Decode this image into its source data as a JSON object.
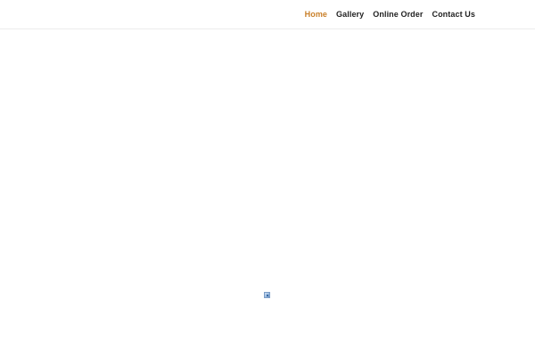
{
  "nav": {
    "items": [
      {
        "label": "Home",
        "active": true
      },
      {
        "label": "Gallery",
        "active": false
      },
      {
        "label": "Online Order",
        "active": false
      },
      {
        "label": "Contact Us",
        "active": false
      }
    ]
  },
  "colors": {
    "accent": "#c9802a",
    "nav_text": "#222222",
    "background": "#ffffff"
  },
  "content": {
    "image_icon": "broken-image-icon"
  }
}
